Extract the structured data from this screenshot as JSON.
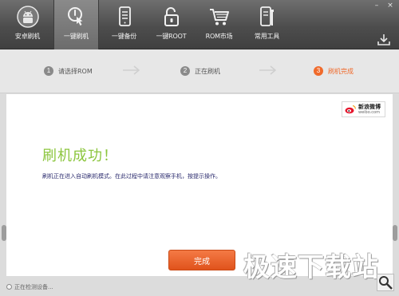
{
  "nav": {
    "items": [
      {
        "label": "安卓刷机",
        "icon": "android-robot-icon"
      },
      {
        "label": "一键刷机",
        "icon": "touch-flash-icon"
      },
      {
        "label": "一键备份",
        "icon": "phone-backup-icon"
      },
      {
        "label": "一键ROOT",
        "icon": "unlock-root-icon"
      },
      {
        "label": "ROM市场",
        "icon": "shopping-cart-icon"
      },
      {
        "label": "常用工具",
        "icon": "phone-tools-icon"
      }
    ],
    "active_index": 1
  },
  "window_controls": {
    "minimize": "–",
    "close": "×"
  },
  "steps": {
    "items": [
      {
        "num": "1",
        "label": "请选择ROM"
      },
      {
        "num": "2",
        "label": "正在刷机"
      },
      {
        "num": "3",
        "label": "刷机完成"
      }
    ],
    "current_index": 2
  },
  "content": {
    "weibo": {
      "line1": "新浪微博",
      "line2": "weibo.com"
    },
    "title": "刷机成功！",
    "description": "刷机正在进入自动刷机模式。在此过程中请注意观察手机，按提示操作。",
    "finish_button": "完成"
  },
  "status": {
    "text": "正在检测设备..."
  },
  "watermark": "极速下载站",
  "colors": {
    "accent": "#f06a2b",
    "success": "#8cc63e",
    "topbar": "#4d4d4d"
  }
}
